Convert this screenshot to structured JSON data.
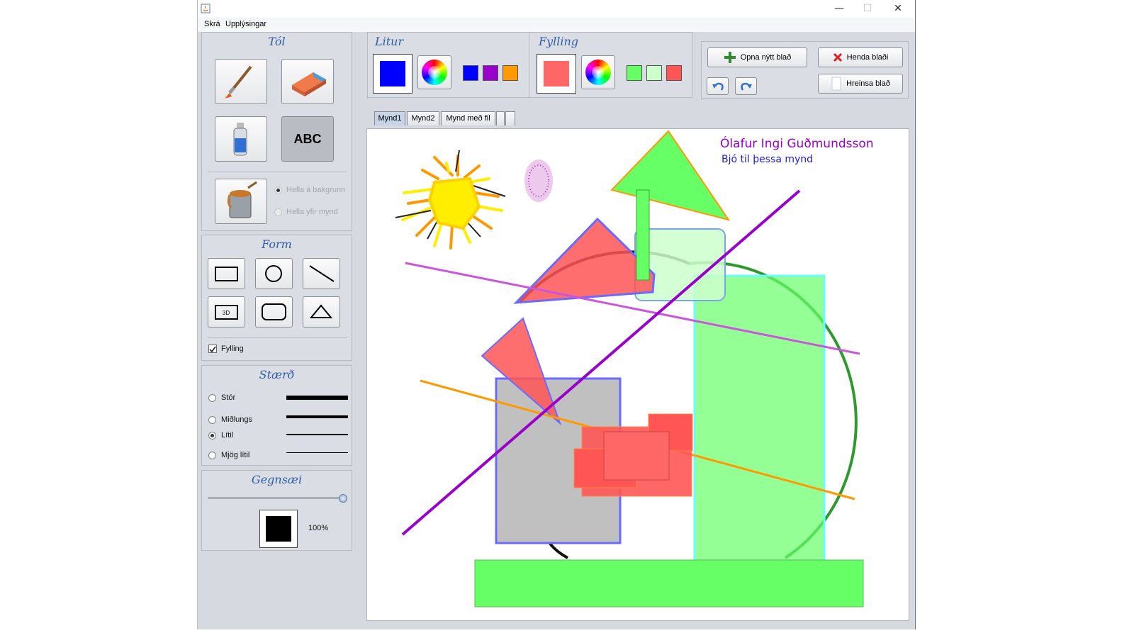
{
  "menu": [
    "Skrá",
    "Upplýsingar"
  ],
  "window_controls": {
    "minimize": "—",
    "maximize": "☐",
    "close": "✕"
  },
  "panels": {
    "tools": "Tól",
    "color": "Litur",
    "fill": "Fylling",
    "shape": "Form",
    "size": "Stærð",
    "transparency": "Gegnsæi"
  },
  "tools": {
    "text_label": "ABC"
  },
  "bucket_options": [
    "Hella á bakgrunn",
    "Hella yfir mynd"
  ],
  "fill_checkbox": "Fylling",
  "sizes": [
    "Stór",
    "Miðlungs",
    "Lítil",
    "Mjög lítil"
  ],
  "selected_size": "Lítil",
  "transparency": {
    "value": 1.0,
    "label": "100%",
    "preview_color": "#000000"
  },
  "color": {
    "current": "#0000ff",
    "recent": [
      "#0000ff",
      "#9900cc",
      "#ff9900"
    ]
  },
  "fill": {
    "current": "#ff6666",
    "recent": [
      "#66ff66",
      "#ccffcc",
      "#ff5555"
    ]
  },
  "actions": {
    "new": "Opna nýtt blað",
    "discard": "Henda blaði",
    "clear": "Hreinsa blað"
  },
  "tabs": [
    "Mynd1",
    "Mynd2",
    "Mynd með fil",
    "",
    ""
  ],
  "selected_tab": "Mynd1",
  "canvas": {
    "author": "Ólafur Ingi Guðmundsson",
    "caption": "Bjó til þessa mynd"
  }
}
